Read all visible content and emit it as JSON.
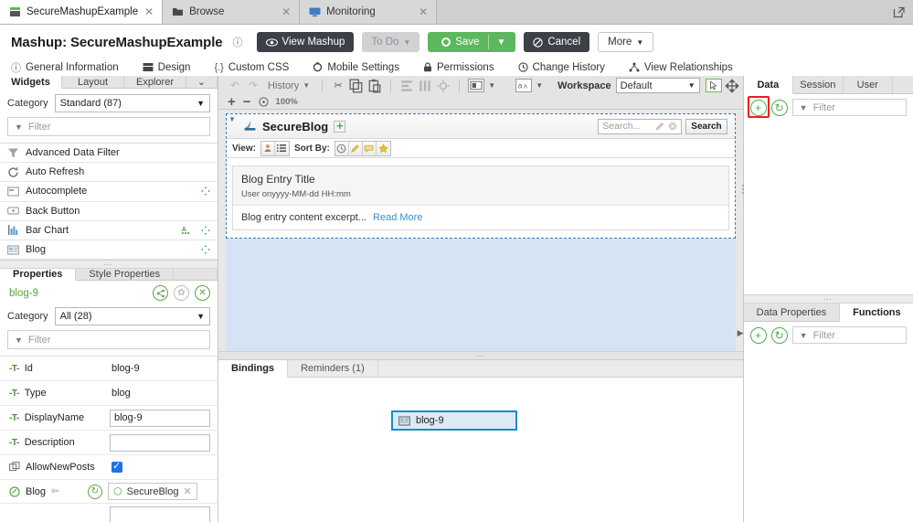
{
  "browser_tabs": [
    {
      "label": "SecureMashupExample",
      "icon": "mashup-icon",
      "active": true,
      "close": "✕"
    },
    {
      "label": "Browse",
      "icon": "folder-icon",
      "active": false,
      "close": "✕"
    },
    {
      "label": "Monitoring",
      "icon": "monitor-icon",
      "active": false,
      "close": "✕"
    }
  ],
  "header": {
    "title": "Mashup: SecureMashupExample",
    "info_glyph": "ⓘ",
    "buttons": {
      "view_mashup": "View Mashup",
      "todo": "To Do",
      "save": "Save",
      "cancel": "Cancel",
      "more": "More"
    }
  },
  "subnav": [
    {
      "label": "General Information",
      "icon": "info-icon",
      "active": false
    },
    {
      "label": "Design",
      "icon": "design-icon",
      "active": true
    },
    {
      "label": "Custom CSS",
      "icon": "braces-icon",
      "active": false
    },
    {
      "label": "Mobile Settings",
      "icon": "gear-icon",
      "active": false
    },
    {
      "label": "Permissions",
      "icon": "lock-icon",
      "active": false
    },
    {
      "label": "Change History",
      "icon": "clock-icon",
      "active": false
    },
    {
      "label": "View Relationships",
      "icon": "relationships-icon",
      "active": false
    }
  ],
  "left_panel": {
    "tabs": [
      {
        "label": "Widgets",
        "active": true
      },
      {
        "label": "Layout",
        "active": false
      },
      {
        "label": "Explorer",
        "active": false
      }
    ],
    "chevron": "⌄",
    "category_label": "Category",
    "category_value": "Standard (87)",
    "filter_placeholder": "Filter",
    "widgets": [
      {
        "name": "Advanced Data Filter",
        "icon": "funnel-icon",
        "draggable": false,
        "has_a": false
      },
      {
        "name": "Auto Refresh",
        "icon": "refresh-clock-icon",
        "draggable": false,
        "has_a": false
      },
      {
        "name": "Autocomplete",
        "icon": "autocomplete-icon",
        "draggable": true,
        "has_a": false
      },
      {
        "name": "Back Button",
        "icon": "back-button-icon",
        "draggable": false,
        "has_a": false
      },
      {
        "name": "Bar Chart",
        "icon": "bar-chart-icon",
        "draggable": true,
        "has_a": true
      },
      {
        "name": "Blog",
        "icon": "blog-icon",
        "draggable": true,
        "has_a": false
      }
    ]
  },
  "properties_panel": {
    "tabs": [
      {
        "label": "Properties",
        "active": true
      },
      {
        "label": "Style Properties",
        "active": false
      }
    ],
    "selected_widget": "blog-9",
    "actions": {
      "share": "share-icon",
      "gear": "gear-icon",
      "close": "close-icon"
    },
    "category_label": "Category",
    "category_value": "All (28)",
    "filter_placeholder": "Filter",
    "rows": [
      {
        "label": "Id",
        "icon": "text-type-icon",
        "kind": "static",
        "value": "blog-9"
      },
      {
        "label": "Type",
        "icon": "text-type-icon",
        "kind": "static",
        "value": "blog"
      },
      {
        "label": "DisplayName",
        "icon": "text-type-icon",
        "kind": "input",
        "value": "blog-9"
      },
      {
        "label": "Description",
        "icon": "text-type-icon",
        "kind": "input",
        "value": ""
      },
      {
        "label": "AllowNewPosts",
        "icon": "boolean-icon",
        "kind": "checkbox",
        "value": "true"
      },
      {
        "label": "Blog",
        "icon": "entity-icon",
        "kind": "entity",
        "value": "SecureBlog",
        "bound": "⇦"
      }
    ]
  },
  "toolbar": {
    "undo": "undo-icon",
    "redo": "redo-icon",
    "history": "History",
    "cut": "cut-icon",
    "copy": "copy-icon",
    "paste": "paste-icon",
    "align": "align-icon",
    "distribute": "distribute-icon",
    "anchor": "anchor-icon",
    "layout_mode": "layout-icon",
    "text_mode": "text-style-icon",
    "workspace_label": "Workspace",
    "workspace_value": "Default",
    "select_tool": "select-cursor-icon",
    "move_tool": "move-icon",
    "zoom_in": "+",
    "zoom_out": "−",
    "zoom_reset": "zoom-reset-icon",
    "zoom_level": "100%"
  },
  "canvas": {
    "widget": {
      "title": "SecureBlog",
      "add_label": "+",
      "search_placeholder": "Search...",
      "search_button": "Search",
      "view_label": "View:",
      "sort_label": "Sort By:",
      "view_icons": [
        "user-view-icon",
        "list-view-icon"
      ],
      "sort_icons": [
        "clock-icon",
        "pencil-icon",
        "comment-icon",
        "star-icon"
      ],
      "entry": {
        "title": "Blog Entry Title",
        "meta": "User onyyyy-MM-dd HH:mm",
        "excerpt": "Blog entry content excerpt...",
        "read_more": "Read More"
      }
    }
  },
  "bindings_panel": {
    "tabs": [
      {
        "label": "Bindings",
        "active": true
      },
      {
        "label": "Reminders (1)",
        "active": false
      }
    ],
    "node": {
      "label": "blog-9",
      "icon": "blog-icon"
    }
  },
  "right_panel": {
    "tabs": [
      {
        "label": "Data",
        "active": true
      },
      {
        "label": "Session",
        "active": false
      },
      {
        "label": "User",
        "active": false
      }
    ],
    "add_button": "+",
    "refresh_button": "refresh-icon",
    "filter_placeholder": "Filter",
    "highlight_color": "#f01e1e"
  },
  "right_lower_panel": {
    "tabs": [
      {
        "label": "Data Properties",
        "active": false
      },
      {
        "label": "Functions",
        "active": true
      }
    ],
    "add_button": "+",
    "refresh_button": "refresh-icon",
    "filter_placeholder": "Filter"
  },
  "colors": {
    "accent_green": "#5cb85c",
    "dark_button": "#3b4147",
    "selection_blue": "#1a8cc8",
    "highlight_red": "#f01e1e",
    "link_blue": "#3a8ed0"
  }
}
